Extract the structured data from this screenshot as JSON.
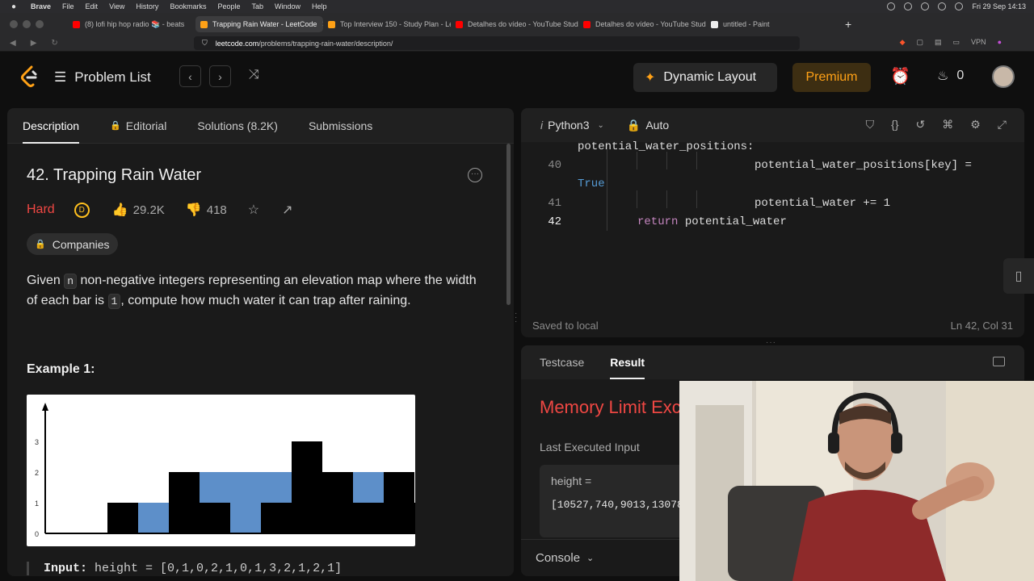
{
  "menubar": {
    "apple": "",
    "items": [
      "Brave",
      "File",
      "Edit",
      "View",
      "History",
      "Bookmarks",
      "People",
      "Tab",
      "Window",
      "Help"
    ],
    "clock": "Fri 29 Sep  14:13"
  },
  "tabs": [
    {
      "title": "(8) lofi hip hop radio 📚 - beats",
      "fav_color": "#ff0000"
    },
    {
      "title": "Trapping Rain Water - LeetCode",
      "fav_color": "#ffa116",
      "active": true
    },
    {
      "title": "Top Interview 150 - Study Plan - Le",
      "fav_color": "#ffa116"
    },
    {
      "title": "Detalhes do vídeo - YouTube Studio",
      "fav_color": "#ff0000"
    },
    {
      "title": "Detalhes do vídeo - YouTube Studio",
      "fav_color": "#ff0000"
    },
    {
      "title": "untitled - Paint",
      "fav_color": "#eeeeee"
    }
  ],
  "urlbar": {
    "host": "leetcode.com",
    "path": "/problems/trapping-rain-water/description/",
    "vpn": "VPN",
    "shield_count": "4"
  },
  "header": {
    "problem_list": "Problem List",
    "dynamic_layout": "Dynamic Layout",
    "premium": "Premium",
    "streak": "0"
  },
  "left": {
    "tabs": [
      "Description",
      "Editorial",
      "Solutions (8.2K)",
      "Submissions"
    ],
    "title": "42. Trapping Rain Water",
    "difficulty": "Hard",
    "likes": "29.2K",
    "dislikes": "418",
    "companies": "Companies",
    "desc": {
      "p1": "Given ",
      "n": "n",
      "p2": " non-negative integers representing an elevation map where the width of each bar is ",
      "one": "1",
      "p3": ", compute how much water it can trap after raining."
    },
    "example_label": "Example 1:",
    "figure": {
      "bars": [
        0,
        1,
        0,
        2,
        1,
        0,
        1,
        3,
        2,
        1,
        2,
        1
      ],
      "water": [
        0,
        0,
        1,
        0,
        1,
        2,
        1,
        0,
        0,
        1,
        0,
        0
      ],
      "yticks": [
        "0",
        "1",
        "2",
        "3"
      ]
    },
    "input_label": "Input:",
    "input_value": "height = [0,1,0,2,1,0,1,3,2,1,2,1]"
  },
  "editor": {
    "language": "Python3",
    "auto": "Auto",
    "lines": [
      {
        "num": "",
        "text": "potential_water_positions:"
      },
      {
        "num": "40",
        "text": "potential_water_positions[key] ="
      },
      {
        "num": "",
        "text": "True"
      },
      {
        "num": "41",
        "text": "potential_water += 1"
      },
      {
        "num": "42",
        "kw": "return",
        "text": " potential_water"
      }
    ],
    "saved": "Saved to local",
    "position": "Ln 42, Col 31"
  },
  "result": {
    "tabs": [
      "Testcase",
      "Result"
    ],
    "verdict": "Memory Limit Exceeded",
    "last_input_label": "Last Executed Input",
    "param": "height =",
    "value": "[10527,740,9013,13078,11522,9190,6389,5544,16254,2247,11..."
  },
  "console": "Console"
}
